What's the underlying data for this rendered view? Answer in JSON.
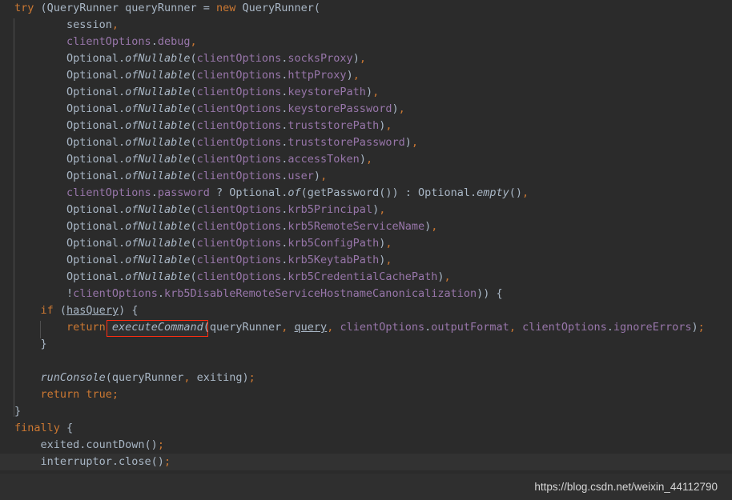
{
  "editor": {
    "language": "Java",
    "theme": "Darcula",
    "background_color": "#2b2b2b",
    "current_line_color": "#323232",
    "indent_guide_color": "#4f4f4f",
    "default_text_color": "#a9b7c6",
    "keyword_color": "#cc7832",
    "field_color": "#9876aa",
    "error_box_color": "#ff2d11",
    "current_line_index": 27,
    "error_box": {
      "label": "executeCommand(",
      "line_index": 19,
      "tooltip": "executeCommand("
    },
    "lines": [
      {
        "indent": 0,
        "tokens": [
          {
            "t": "try ",
            "c": "kw"
          },
          {
            "t": "(QueryRunner queryRunner = ",
            "c": "pl"
          },
          {
            "t": "new ",
            "c": "kw"
          },
          {
            "t": "QueryRunner(",
            "c": "pl"
          }
        ]
      },
      {
        "indent": 0,
        "tokens": [
          {
            "t": "        session",
            "c": "pl"
          },
          {
            "t": ",",
            "c": "punct"
          }
        ]
      },
      {
        "indent": 0,
        "tokens": [
          {
            "t": "        clientOptions",
            "c": "fld"
          },
          {
            "t": ".",
            "c": "pl"
          },
          {
            "t": "debug",
            "c": "fld"
          },
          {
            "t": ",",
            "c": "punct"
          }
        ]
      },
      {
        "indent": 0,
        "tokens": [
          {
            "t": "        Optional.",
            "c": "pl"
          },
          {
            "t": "ofNullable",
            "c": "stat"
          },
          {
            "t": "(",
            "c": "pl"
          },
          {
            "t": "clientOptions",
            "c": "fld"
          },
          {
            "t": ".",
            "c": "pl"
          },
          {
            "t": "socksProxy",
            "c": "fld"
          },
          {
            "t": ")",
            "c": "pl"
          },
          {
            "t": ",",
            "c": "punct"
          }
        ]
      },
      {
        "indent": 0,
        "tokens": [
          {
            "t": "        Optional.",
            "c": "pl"
          },
          {
            "t": "ofNullable",
            "c": "stat"
          },
          {
            "t": "(",
            "c": "pl"
          },
          {
            "t": "clientOptions",
            "c": "fld"
          },
          {
            "t": ".",
            "c": "pl"
          },
          {
            "t": "httpProxy",
            "c": "fld"
          },
          {
            "t": ")",
            "c": "pl"
          },
          {
            "t": ",",
            "c": "punct"
          }
        ]
      },
      {
        "indent": 0,
        "tokens": [
          {
            "t": "        Optional.",
            "c": "pl"
          },
          {
            "t": "ofNullable",
            "c": "stat"
          },
          {
            "t": "(",
            "c": "pl"
          },
          {
            "t": "clientOptions",
            "c": "fld"
          },
          {
            "t": ".",
            "c": "pl"
          },
          {
            "t": "keystorePath",
            "c": "fld"
          },
          {
            "t": ")",
            "c": "pl"
          },
          {
            "t": ",",
            "c": "punct"
          }
        ]
      },
      {
        "indent": 0,
        "tokens": [
          {
            "t": "        Optional.",
            "c": "pl"
          },
          {
            "t": "ofNullable",
            "c": "stat"
          },
          {
            "t": "(",
            "c": "pl"
          },
          {
            "t": "clientOptions",
            "c": "fld"
          },
          {
            "t": ".",
            "c": "pl"
          },
          {
            "t": "keystorePassword",
            "c": "fld"
          },
          {
            "t": ")",
            "c": "pl"
          },
          {
            "t": ",",
            "c": "punct"
          }
        ]
      },
      {
        "indent": 0,
        "tokens": [
          {
            "t": "        Optional.",
            "c": "pl"
          },
          {
            "t": "ofNullable",
            "c": "stat"
          },
          {
            "t": "(",
            "c": "pl"
          },
          {
            "t": "clientOptions",
            "c": "fld"
          },
          {
            "t": ".",
            "c": "pl"
          },
          {
            "t": "truststorePath",
            "c": "fld"
          },
          {
            "t": ")",
            "c": "pl"
          },
          {
            "t": ",",
            "c": "punct"
          }
        ]
      },
      {
        "indent": 0,
        "tokens": [
          {
            "t": "        Optional.",
            "c": "pl"
          },
          {
            "t": "ofNullable",
            "c": "stat"
          },
          {
            "t": "(",
            "c": "pl"
          },
          {
            "t": "clientOptions",
            "c": "fld"
          },
          {
            "t": ".",
            "c": "pl"
          },
          {
            "t": "truststorePassword",
            "c": "fld"
          },
          {
            "t": ")",
            "c": "pl"
          },
          {
            "t": ",",
            "c": "punct"
          }
        ]
      },
      {
        "indent": 0,
        "tokens": [
          {
            "t": "        Optional.",
            "c": "pl"
          },
          {
            "t": "ofNullable",
            "c": "stat"
          },
          {
            "t": "(",
            "c": "pl"
          },
          {
            "t": "clientOptions",
            "c": "fld"
          },
          {
            "t": ".",
            "c": "pl"
          },
          {
            "t": "accessToken",
            "c": "fld"
          },
          {
            "t": ")",
            "c": "pl"
          },
          {
            "t": ",",
            "c": "punct"
          }
        ]
      },
      {
        "indent": 0,
        "tokens": [
          {
            "t": "        Optional.",
            "c": "pl"
          },
          {
            "t": "ofNullable",
            "c": "stat"
          },
          {
            "t": "(",
            "c": "pl"
          },
          {
            "t": "clientOptions",
            "c": "fld"
          },
          {
            "t": ".",
            "c": "pl"
          },
          {
            "t": "user",
            "c": "fld"
          },
          {
            "t": ")",
            "c": "pl"
          },
          {
            "t": ",",
            "c": "punct"
          }
        ]
      },
      {
        "indent": 0,
        "tokens": [
          {
            "t": "        clientOptions",
            "c": "fld"
          },
          {
            "t": ".",
            "c": "pl"
          },
          {
            "t": "password",
            "c": "fld"
          },
          {
            "t": " ? Optional.",
            "c": "pl"
          },
          {
            "t": "of",
            "c": "stat"
          },
          {
            "t": "(getPassword()) : Optional.",
            "c": "pl"
          },
          {
            "t": "empty",
            "c": "stat"
          },
          {
            "t": "()",
            "c": "pl"
          },
          {
            "t": ",",
            "c": "punct"
          }
        ]
      },
      {
        "indent": 0,
        "tokens": [
          {
            "t": "        Optional.",
            "c": "pl"
          },
          {
            "t": "ofNullable",
            "c": "stat"
          },
          {
            "t": "(",
            "c": "pl"
          },
          {
            "t": "clientOptions",
            "c": "fld"
          },
          {
            "t": ".",
            "c": "pl"
          },
          {
            "t": "krb5Principal",
            "c": "fld"
          },
          {
            "t": ")",
            "c": "pl"
          },
          {
            "t": ",",
            "c": "punct"
          }
        ]
      },
      {
        "indent": 0,
        "tokens": [
          {
            "t": "        Optional.",
            "c": "pl"
          },
          {
            "t": "ofNullable",
            "c": "stat"
          },
          {
            "t": "(",
            "c": "pl"
          },
          {
            "t": "clientOptions",
            "c": "fld"
          },
          {
            "t": ".",
            "c": "pl"
          },
          {
            "t": "krb5RemoteServiceName",
            "c": "fld"
          },
          {
            "t": ")",
            "c": "pl"
          },
          {
            "t": ",",
            "c": "punct"
          }
        ]
      },
      {
        "indent": 0,
        "tokens": [
          {
            "t": "        Optional.",
            "c": "pl"
          },
          {
            "t": "ofNullable",
            "c": "stat"
          },
          {
            "t": "(",
            "c": "pl"
          },
          {
            "t": "clientOptions",
            "c": "fld"
          },
          {
            "t": ".",
            "c": "pl"
          },
          {
            "t": "krb5ConfigPath",
            "c": "fld"
          },
          {
            "t": ")",
            "c": "pl"
          },
          {
            "t": ",",
            "c": "punct"
          }
        ]
      },
      {
        "indent": 0,
        "tokens": [
          {
            "t": "        Optional.",
            "c": "pl"
          },
          {
            "t": "ofNullable",
            "c": "stat"
          },
          {
            "t": "(",
            "c": "pl"
          },
          {
            "t": "clientOptions",
            "c": "fld"
          },
          {
            "t": ".",
            "c": "pl"
          },
          {
            "t": "krb5KeytabPath",
            "c": "fld"
          },
          {
            "t": ")",
            "c": "pl"
          },
          {
            "t": ",",
            "c": "punct"
          }
        ]
      },
      {
        "indent": 0,
        "tokens": [
          {
            "t": "        Optional.",
            "c": "pl"
          },
          {
            "t": "ofNullable",
            "c": "stat"
          },
          {
            "t": "(",
            "c": "pl"
          },
          {
            "t": "clientOptions",
            "c": "fld"
          },
          {
            "t": ".",
            "c": "pl"
          },
          {
            "t": "krb5CredentialCachePath",
            "c": "fld"
          },
          {
            "t": ")",
            "c": "pl"
          },
          {
            "t": ",",
            "c": "punct"
          }
        ]
      },
      {
        "indent": 0,
        "tokens": [
          {
            "t": "        !",
            "c": "pl"
          },
          {
            "t": "clientOptions",
            "c": "fld"
          },
          {
            "t": ".",
            "c": "pl"
          },
          {
            "t": "krb5DisableRemoteServiceHostnameCanonicalization",
            "c": "fld"
          },
          {
            "t": ")) {",
            "c": "pl"
          }
        ]
      },
      {
        "indent": 0,
        "tokens": [
          {
            "t": "    if ",
            "c": "kw"
          },
          {
            "t": "(",
            "c": "pl"
          },
          {
            "t": "hasQuery",
            "c": "pl und"
          },
          {
            "t": ") {",
            "c": "pl"
          }
        ]
      },
      {
        "indent": 0,
        "tokens": [
          {
            "t": "        return ",
            "c": "kw"
          },
          {
            "t": "executeCommand",
            "c": "stat"
          },
          {
            "t": "(queryRunner",
            "c": "pl"
          },
          {
            "t": ",",
            "c": "punct"
          },
          {
            "t": " ",
            "c": "pl"
          },
          {
            "t": "query",
            "c": "pl und"
          },
          {
            "t": ",",
            "c": "punct"
          },
          {
            "t": " ",
            "c": "pl"
          },
          {
            "t": "clientOptions",
            "c": "fld"
          },
          {
            "t": ".",
            "c": "pl"
          },
          {
            "t": "outputFormat",
            "c": "fld"
          },
          {
            "t": ",",
            "c": "punct"
          },
          {
            "t": " ",
            "c": "pl"
          },
          {
            "t": "clientOptions",
            "c": "fld"
          },
          {
            "t": ".",
            "c": "pl"
          },
          {
            "t": "ignoreErrors",
            "c": "fld"
          },
          {
            "t": ")",
            "c": "pl"
          },
          {
            "t": ";",
            "c": "punct"
          }
        ]
      },
      {
        "indent": 0,
        "tokens": [
          {
            "t": "    }",
            "c": "pl"
          }
        ]
      },
      {
        "indent": 0,
        "tokens": [
          {
            "t": "",
            "c": "pl"
          }
        ]
      },
      {
        "indent": 0,
        "tokens": [
          {
            "t": "    ",
            "c": "pl"
          },
          {
            "t": "runConsole",
            "c": "stat"
          },
          {
            "t": "(queryRunner",
            "c": "pl"
          },
          {
            "t": ",",
            "c": "punct"
          },
          {
            "t": " exiting)",
            "c": "pl"
          },
          {
            "t": ";",
            "c": "punct"
          }
        ]
      },
      {
        "indent": 0,
        "tokens": [
          {
            "t": "    return true",
            "c": "kw"
          },
          {
            "t": ";",
            "c": "punct"
          }
        ]
      },
      {
        "indent": 0,
        "tokens": [
          {
            "t": "}",
            "c": "pl"
          }
        ]
      },
      {
        "indent": 0,
        "tokens": [
          {
            "t": "finally ",
            "c": "kw"
          },
          {
            "t": "{",
            "c": "pl"
          }
        ]
      },
      {
        "indent": 0,
        "tokens": [
          {
            "t": "    exited.countDown()",
            "c": "pl"
          },
          {
            "t": ";",
            "c": "punct"
          }
        ]
      },
      {
        "indent": 0,
        "tokens": [
          {
            "t": "    interruptor.close()",
            "c": "pl"
          },
          {
            "t": ";",
            "c": "punct"
          }
        ]
      },
      {
        "indent": 0,
        "tokens": [
          {
            "t": "}",
            "c": "pl"
          }
        ]
      }
    ],
    "plain_text": "try (QueryRunner queryRunner = new QueryRunner(\n        session,\n        clientOptions.debug,\n        Optional.ofNullable(clientOptions.socksProxy),\n        Optional.ofNullable(clientOptions.httpProxy),\n        Optional.ofNullable(clientOptions.keystorePath),\n        Optional.ofNullable(clientOptions.keystorePassword),\n        Optional.ofNullable(clientOptions.truststorePath),\n        Optional.ofNullable(clientOptions.truststorePassword),\n        Optional.ofNullable(clientOptions.accessToken),\n        Optional.ofNullable(clientOptions.user),\n        clientOptions.password ? Optional.of(getPassword()) : Optional.empty(),\n        Optional.ofNullable(clientOptions.krb5Principal),\n        Optional.ofNullable(clientOptions.krb5RemoteServiceName),\n        Optional.ofNullable(clientOptions.krb5ConfigPath),\n        Optional.ofNullable(clientOptions.krb5KeytabPath),\n        Optional.ofNullable(clientOptions.krb5CredentialCachePath),\n        !clientOptions.krb5DisableRemoteServiceHostnameCanonicalization)) {\n    if (hasQuery) {\n        return executeCommand(queryRunner, query, clientOptions.outputFormat, clientOptions.ignoreErrors);\n    }\n\n    runConsole(queryRunner, exiting);\n    return true;\n}\nfinally {\n    exited.countDown();\n    interruptor.close();\n}"
  },
  "watermark": {
    "url": "https://blog.csdn.net/weixin_44112790",
    "bar_color": "#2f2f2f",
    "text_color": "#d6d6d6"
  }
}
